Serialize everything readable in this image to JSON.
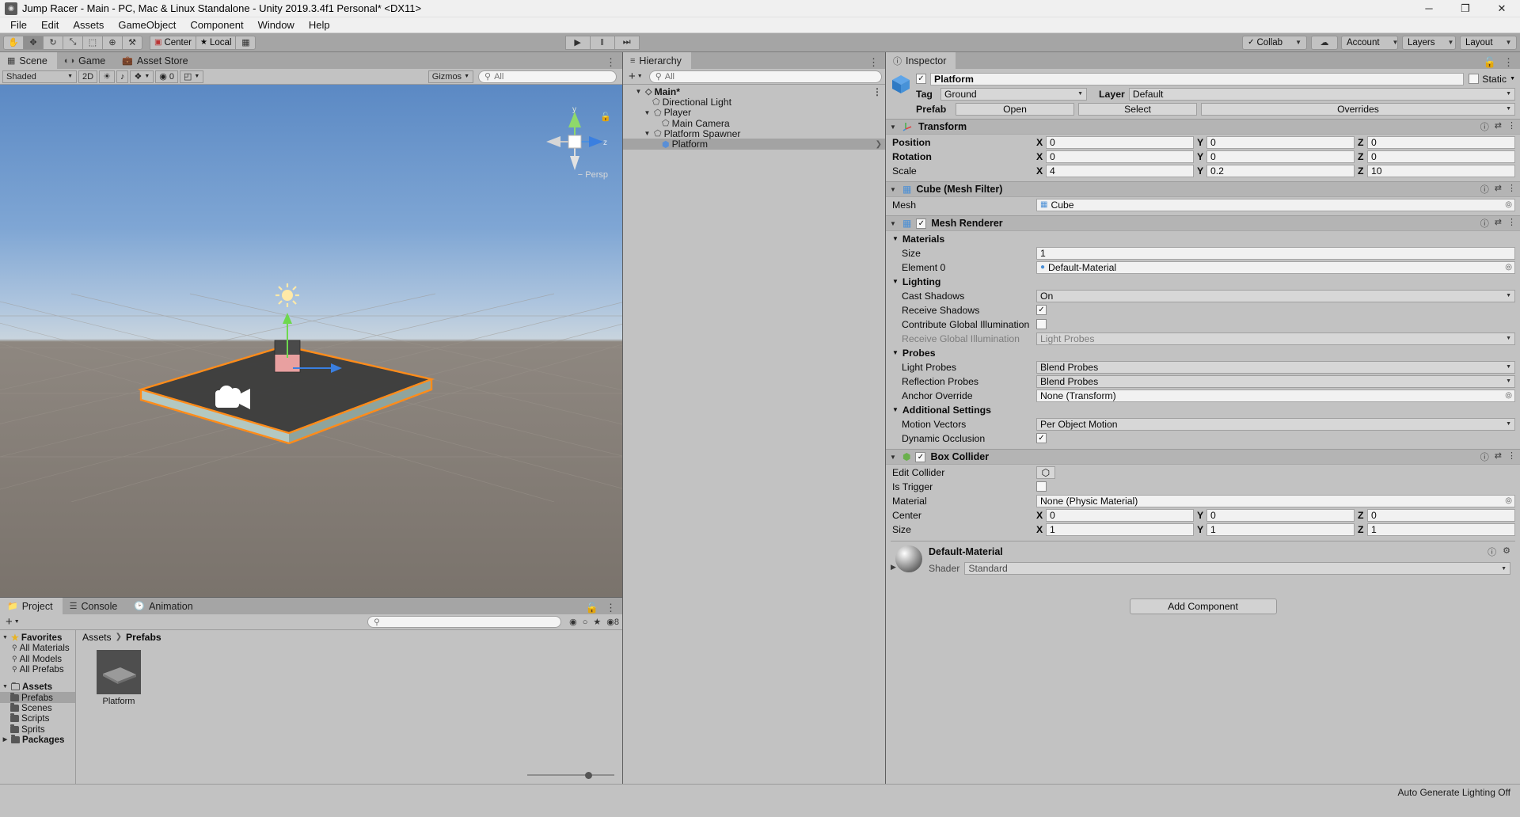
{
  "window": {
    "title": "Jump Racer - Main - PC, Mac & Linux Standalone - Unity 2019.3.4f1 Personal* <DX11>",
    "minimize": "─",
    "maximize": "❐",
    "close": "✕"
  },
  "menu": {
    "items": [
      "File",
      "Edit",
      "Assets",
      "GameObject",
      "Component",
      "Window",
      "Help"
    ]
  },
  "toolbar": {
    "tools": [
      {
        "name": "hand-tool",
        "glyph": "✋",
        "active": false
      },
      {
        "name": "move-tool",
        "glyph": "✥",
        "active": true
      },
      {
        "name": "rotate-tool",
        "glyph": "↻",
        "active": false
      },
      {
        "name": "scale-tool",
        "glyph": "⤡",
        "active": false
      },
      {
        "name": "rect-tool",
        "glyph": "⬚",
        "active": false
      },
      {
        "name": "transform-tool",
        "glyph": "⊕",
        "active": false
      },
      {
        "name": "custom-editor-tool",
        "glyph": "⚒",
        "active": false
      }
    ],
    "pivot_mode": "Center",
    "pivot_rotation": "Local",
    "grid_snap": "▦",
    "play": "▶",
    "pause": "‖",
    "step": "⏭",
    "collab": "Collab",
    "cloud": "☁",
    "account": "Account",
    "layers": "Layers",
    "layout": "Layout"
  },
  "scene_panel": {
    "tabs": [
      {
        "label": "Scene",
        "icon": "grid-icon",
        "active": true
      },
      {
        "label": "Game",
        "icon": "gamepad-icon",
        "active": false
      },
      {
        "label": "Asset Store",
        "icon": "store-icon",
        "active": false
      }
    ],
    "draw_mode": "Shaded",
    "mode_2d": "2D",
    "lighting_toggle": "☀",
    "audio_toggle": "♪",
    "fx_toggle": "❖",
    "scene_vis": "◉",
    "vis_count": "0",
    "camera_btn": "◰",
    "gizmos": "Gizmos",
    "search_placeholder": "All",
    "persp_label": "Persp",
    "axis_x": "x",
    "axis_y": "y",
    "axis_z": "z"
  },
  "hierarchy": {
    "title": "Hierarchy",
    "icon": "hierarchy-icon",
    "add_label": "+",
    "search_placeholder": "All",
    "items": [
      {
        "label": "Main*",
        "depth": 0,
        "twisty": "▼",
        "icon": "scene-icon",
        "bold": true,
        "selected": false
      },
      {
        "label": "Directional Light",
        "depth": 1,
        "twisty": "",
        "icon": "gameobject-icon",
        "bold": false,
        "selected": false
      },
      {
        "label": "Player",
        "depth": 1,
        "twisty": "▼",
        "icon": "gameobject-icon",
        "bold": false,
        "selected": false
      },
      {
        "label": "Main Camera",
        "depth": 2,
        "twisty": "",
        "icon": "gameobject-icon",
        "bold": false,
        "selected": false
      },
      {
        "label": "Platform Spawner",
        "depth": 1,
        "twisty": "▼",
        "icon": "gameobject-icon",
        "bold": false,
        "selected": false
      },
      {
        "label": "Platform",
        "depth": 2,
        "twisty": "",
        "icon": "prefab-icon",
        "bold": false,
        "selected": true
      }
    ]
  },
  "inspector": {
    "title": "Inspector",
    "icon": "info-icon",
    "object_name": "Platform",
    "enabled": true,
    "static_label": "Static",
    "tag_label": "Tag",
    "tag_value": "Ground",
    "layer_label": "Layer",
    "layer_value": "Default",
    "prefab_label": "Prefab",
    "prefab_open": "Open",
    "prefab_select": "Select",
    "prefab_overrides": "Overrides",
    "transform": {
      "title": "Transform",
      "icon": "transform-icon",
      "rows": [
        {
          "label": "Position",
          "x": "0",
          "y": "0",
          "z": "0"
        },
        {
          "label": "Rotation",
          "x": "0",
          "y": "0",
          "z": "0"
        },
        {
          "label": "Scale",
          "x": "4",
          "y": "0.2",
          "z": "10"
        }
      ]
    },
    "mesh_filter": {
      "title": "Cube (Mesh Filter)",
      "icon": "meshfilter-icon",
      "mesh_label": "Mesh",
      "mesh_value": "Cube"
    },
    "mesh_renderer": {
      "title": "Mesh Renderer",
      "icon": "meshrenderer-icon",
      "enabled": true,
      "materials_label": "Materials",
      "size_label": "Size",
      "size_value": "1",
      "element_label": "Element 0",
      "element_value": "Default-Material",
      "lighting_label": "Lighting",
      "cast_shadows_label": "Cast Shadows",
      "cast_shadows_value": "On",
      "receive_shadows_label": "Receive Shadows",
      "receive_shadows_value": true,
      "contribute_gi_label": "Contribute Global Illumination",
      "contribute_gi_value": false,
      "receive_gi_label": "Receive Global Illumination",
      "receive_gi_value": "Light Probes",
      "probes_label": "Probes",
      "light_probes_label": "Light Probes",
      "light_probes_value": "Blend Probes",
      "reflection_probes_label": "Reflection Probes",
      "reflection_probes_value": "Blend Probes",
      "anchor_override_label": "Anchor Override",
      "anchor_override_value": "None (Transform)",
      "additional_label": "Additional Settings",
      "motion_vectors_label": "Motion Vectors",
      "motion_vectors_value": "Per Object Motion",
      "dynamic_occlusion_label": "Dynamic Occlusion",
      "dynamic_occlusion_value": true
    },
    "box_collider": {
      "title": "Box Collider",
      "icon": "boxcollider-icon",
      "enabled": true,
      "edit_collider_label": "Edit Collider",
      "edit_collider_glyph": "⬡",
      "is_trigger_label": "Is Trigger",
      "is_trigger_value": false,
      "material_label": "Material",
      "material_value": "None (Physic Material)",
      "center_label": "Center",
      "center": {
        "x": "0",
        "y": "0",
        "z": "0"
      },
      "size_label": "Size",
      "size": {
        "x": "1",
        "y": "1",
        "z": "1"
      }
    },
    "material_preview": {
      "name": "Default-Material",
      "shader_label": "Shader",
      "shader_value": "Standard"
    },
    "add_component": "Add Component"
  },
  "project": {
    "tabs": [
      {
        "label": "Project",
        "icon": "folder-icon",
        "active": true
      },
      {
        "label": "Console",
        "icon": "console-icon",
        "active": false
      },
      {
        "label": "Animation",
        "icon": "clock-icon",
        "active": false
      }
    ],
    "add_label": "+",
    "search_placeholder": "",
    "tree": [
      {
        "label": "Favorites",
        "depth": 0,
        "twisty": "▼",
        "icon": "star-icon",
        "bold": true,
        "selected": false
      },
      {
        "label": "All Materials",
        "depth": 1,
        "twisty": "",
        "icon": "search-icon",
        "bold": false,
        "selected": false
      },
      {
        "label": "All Models",
        "depth": 1,
        "twisty": "",
        "icon": "search-icon",
        "bold": false,
        "selected": false
      },
      {
        "label": "All Prefabs",
        "depth": 1,
        "twisty": "",
        "icon": "search-icon",
        "bold": false,
        "selected": false
      },
      {
        "label": "",
        "depth": 0,
        "twisty": "",
        "icon": "",
        "bold": false,
        "selected": false
      },
      {
        "label": "Assets",
        "depth": 0,
        "twisty": "▼",
        "icon": "folder-open-icon",
        "bold": true,
        "selected": false
      },
      {
        "label": "Prefabs",
        "depth": 1,
        "twisty": "",
        "icon": "folder-icon",
        "bold": false,
        "selected": true
      },
      {
        "label": "Scenes",
        "depth": 1,
        "twisty": "",
        "icon": "folder-icon",
        "bold": false,
        "selected": false
      },
      {
        "label": "Scripts",
        "depth": 1,
        "twisty": "",
        "icon": "folder-icon",
        "bold": false,
        "selected": false
      },
      {
        "label": "Sprits",
        "depth": 1,
        "twisty": "",
        "icon": "folder-icon",
        "bold": false,
        "selected": false
      },
      {
        "label": "Packages",
        "depth": 0,
        "twisty": "▶",
        "icon": "folder-icon",
        "bold": true,
        "selected": false
      }
    ],
    "breadcrumb": [
      "Assets",
      "Prefabs"
    ],
    "assets": [
      {
        "name": "Platform",
        "type": "prefab-thumb"
      }
    ],
    "filter_icons": [
      "◎",
      "⭐"
    ],
    "vis_count": "8"
  },
  "statusbar": {
    "text": "Auto Generate Lighting Off"
  }
}
